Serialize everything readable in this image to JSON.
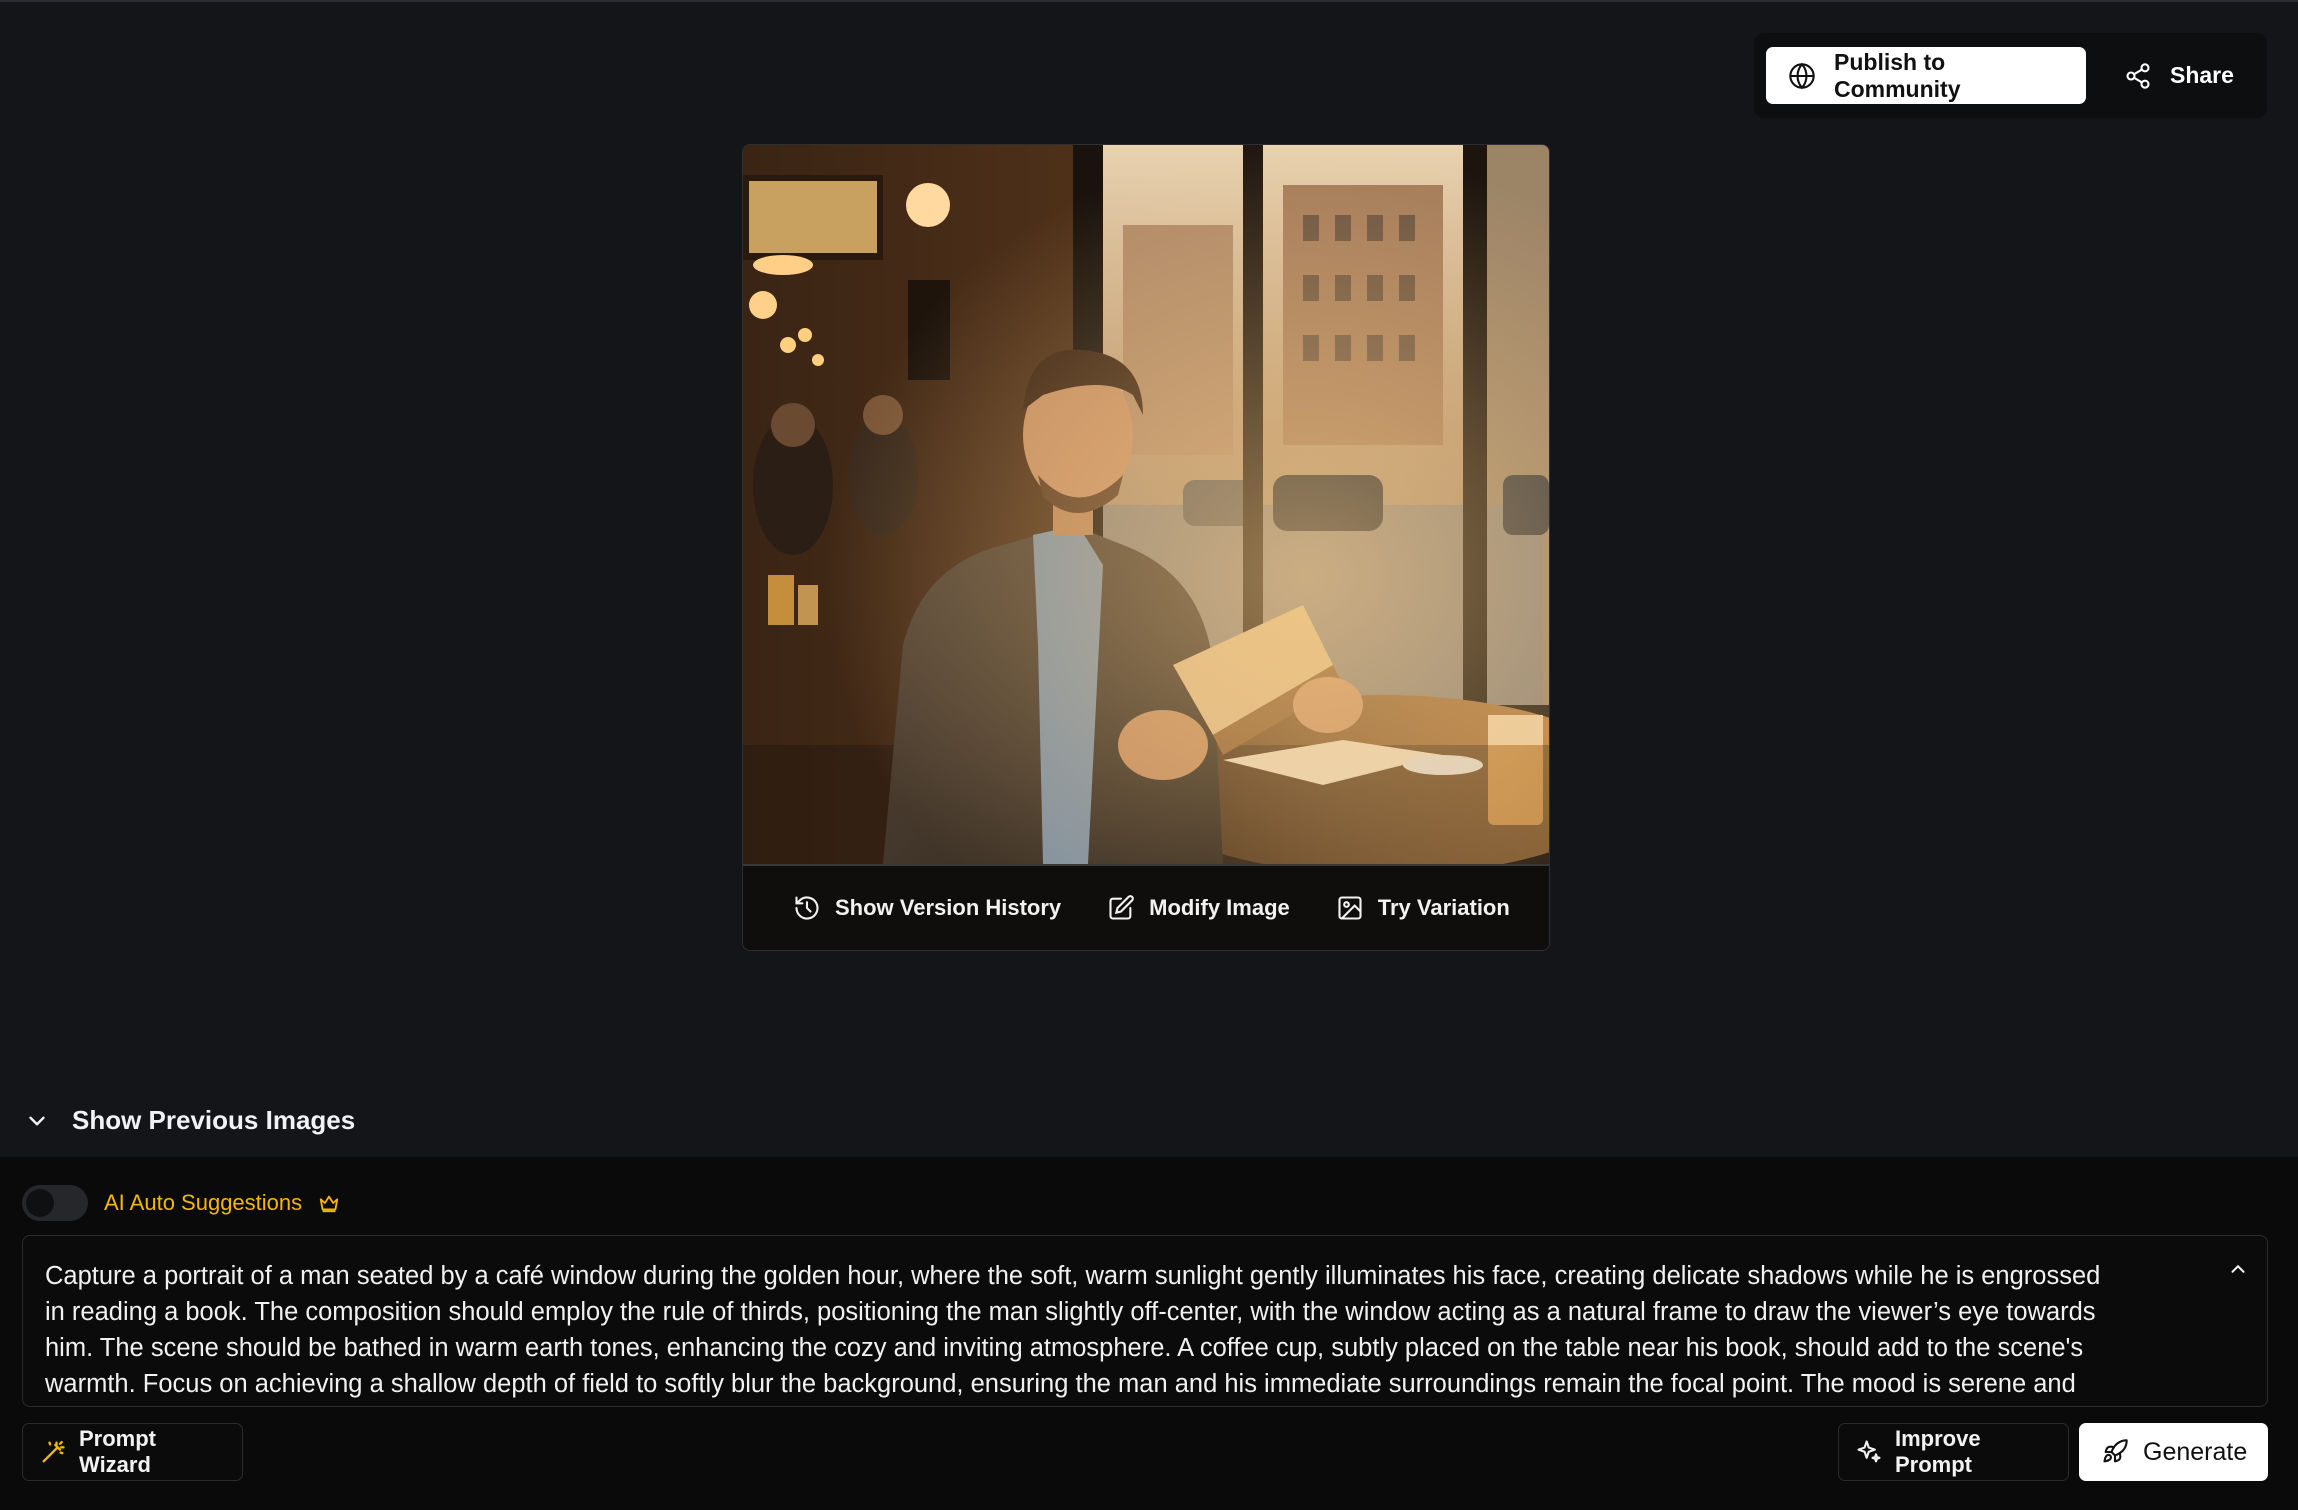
{
  "header": {
    "publish_label": "Publish to Community",
    "share_label": "Share"
  },
  "image_card": {
    "version_history_label": "Show Version History",
    "modify_label": "Modify Image",
    "variation_label": "Try Variation"
  },
  "previous_images": {
    "label": "Show Previous Images"
  },
  "composer": {
    "ai_suggestions_label": "AI Auto Suggestions",
    "ai_suggestions_enabled": false,
    "prompt_text": "Capture a portrait of a man seated by a café window during the golden hour, where the soft, warm sunlight gently illuminates his face, creating delicate shadows while he is engrossed\nin reading a book. The composition should employ the rule of thirds, positioning the man slightly off-center, with the window acting as a natural frame to draw the viewer’s eye towards\nhim. The scene should be bathed in warm earth tones, enhancing the cozy and inviting atmosphere. A coffee cup, subtly placed on the table near his book, should add to the scene's\nwarmth. Focus on achieving a shallow depth of field to softly blur the background, ensuring the man and his immediate surroundings remain the focal point. The mood is serene and",
    "wizard_label": "Prompt Wizard",
    "improve_label": "Improve Prompt",
    "generate_label": "Generate"
  },
  "colors": {
    "background": "#141518",
    "composer_bg": "#0a0a0b",
    "accent_gold": "#f5b700",
    "primary_button": "#ffffff"
  }
}
